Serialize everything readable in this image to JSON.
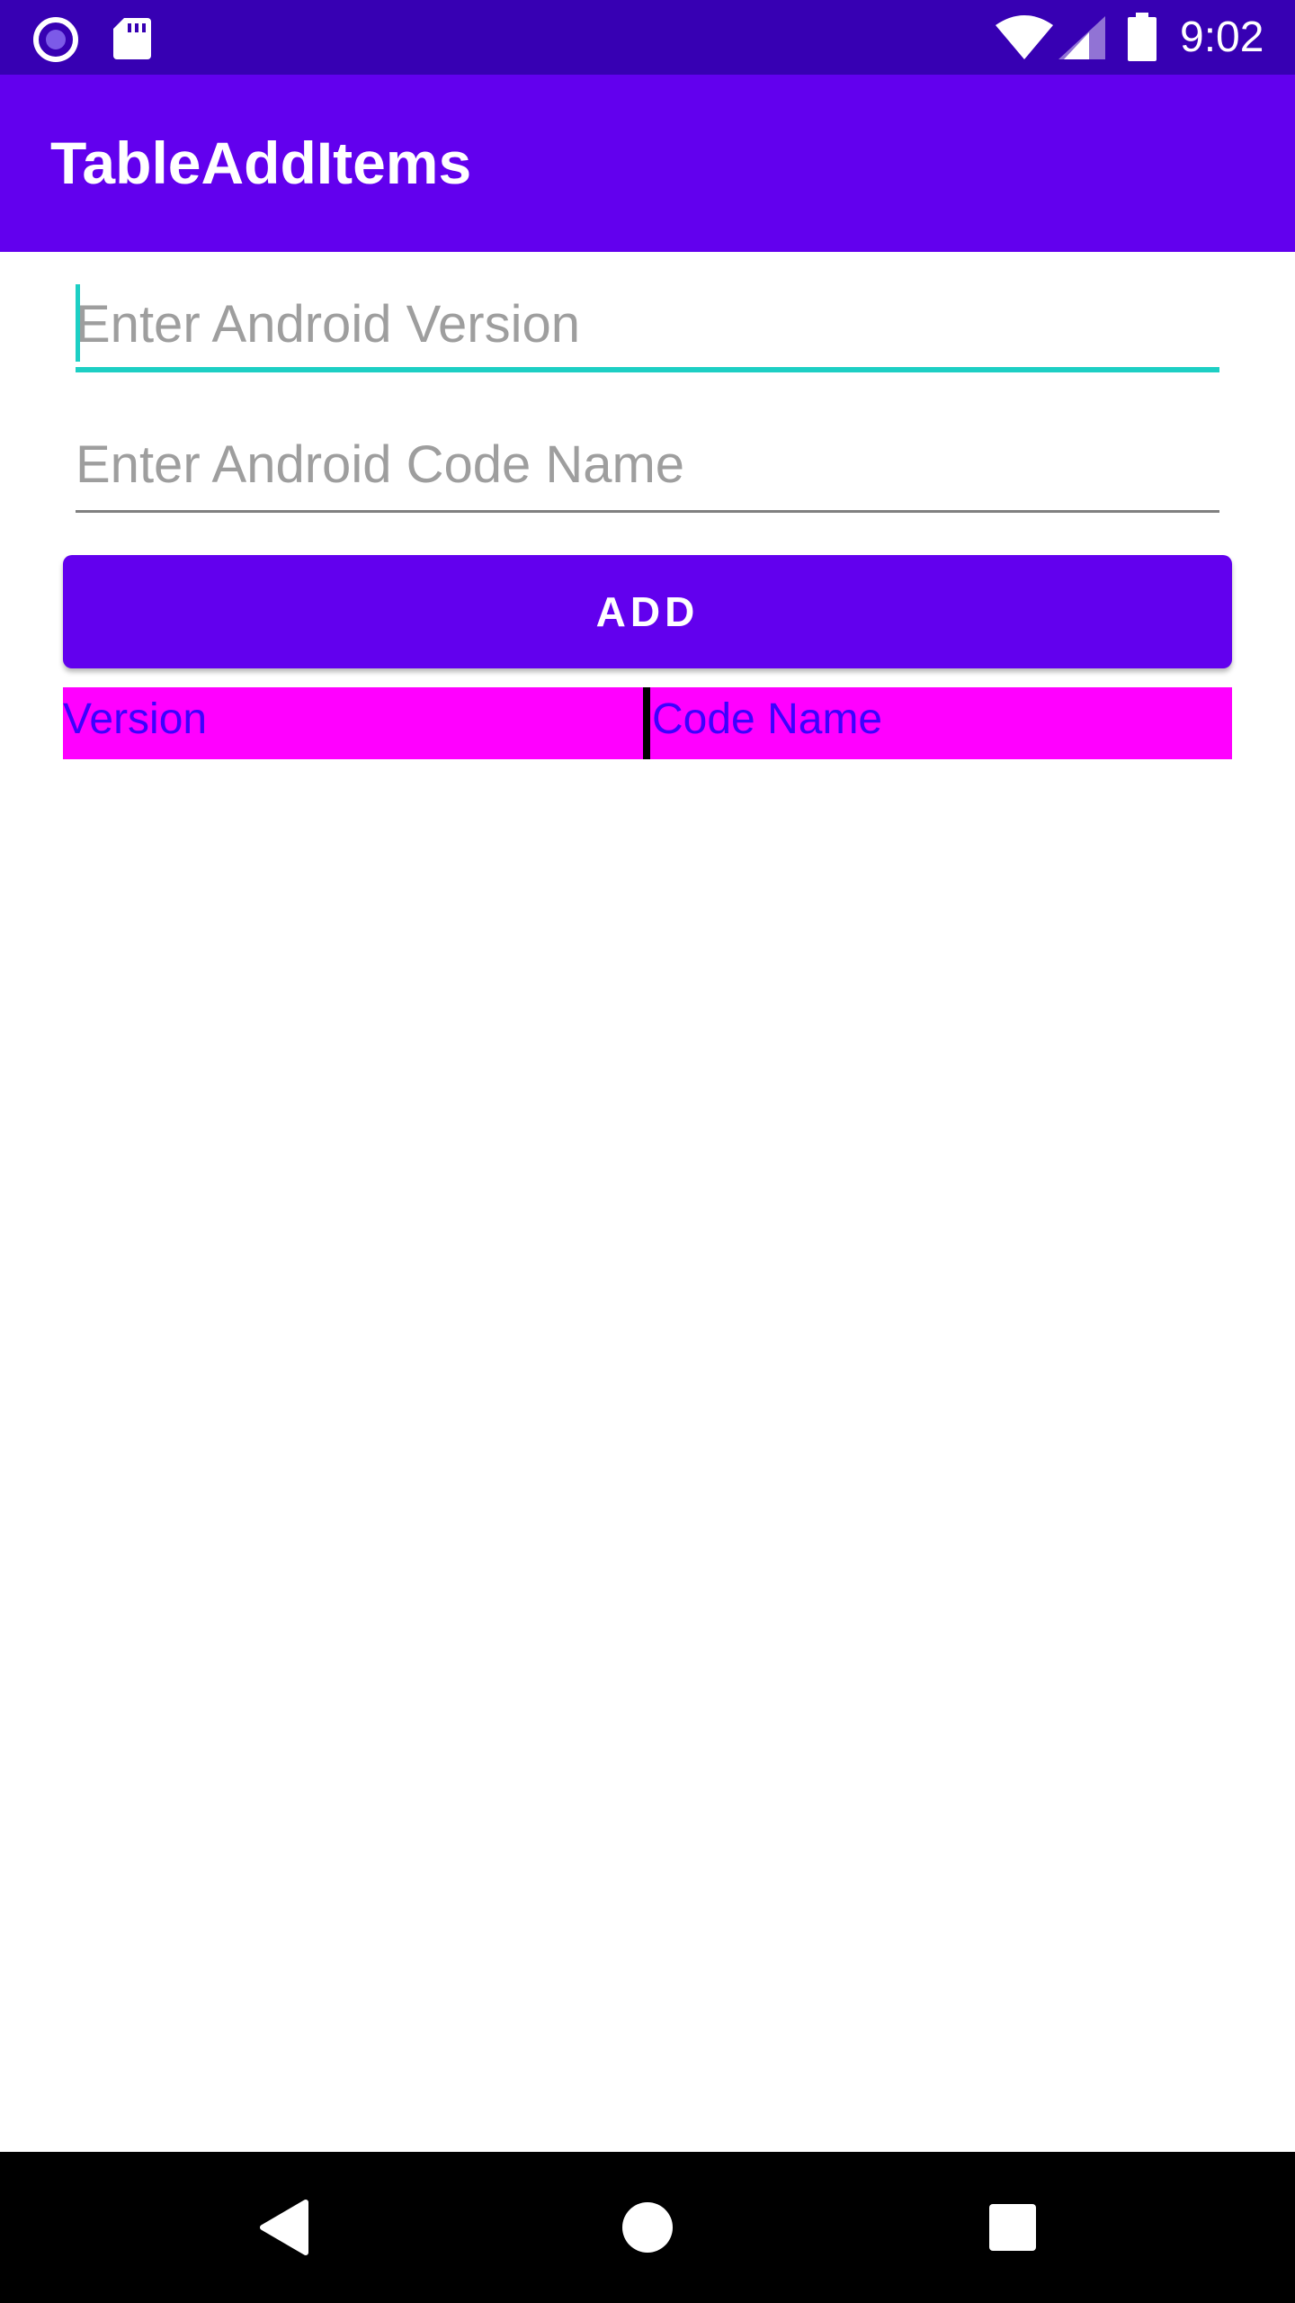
{
  "status_bar": {
    "time": "9:02",
    "icons": [
      "notification-circle-icon",
      "sdcard-icon",
      "wifi-icon",
      "cell-signal-icon",
      "battery-icon"
    ]
  },
  "app_bar": {
    "title": "TableAddItems"
  },
  "form": {
    "version_input": {
      "value": "",
      "placeholder": "Enter Android Version"
    },
    "code_name_input": {
      "value": "",
      "placeholder": "Enter Android Code Name"
    },
    "add_button_label": "ADD"
  },
  "table": {
    "columns": [
      "Version",
      "Code Name"
    ]
  },
  "nav_bar": {
    "icons": [
      "back-icon",
      "home-icon",
      "recents-icon"
    ]
  },
  "colors": {
    "status_bar": "#3700b3",
    "primary": "#6200ee",
    "accent": "#1dcfc4",
    "table_background": "#ff00ff",
    "table_text": "#3d00ff"
  }
}
